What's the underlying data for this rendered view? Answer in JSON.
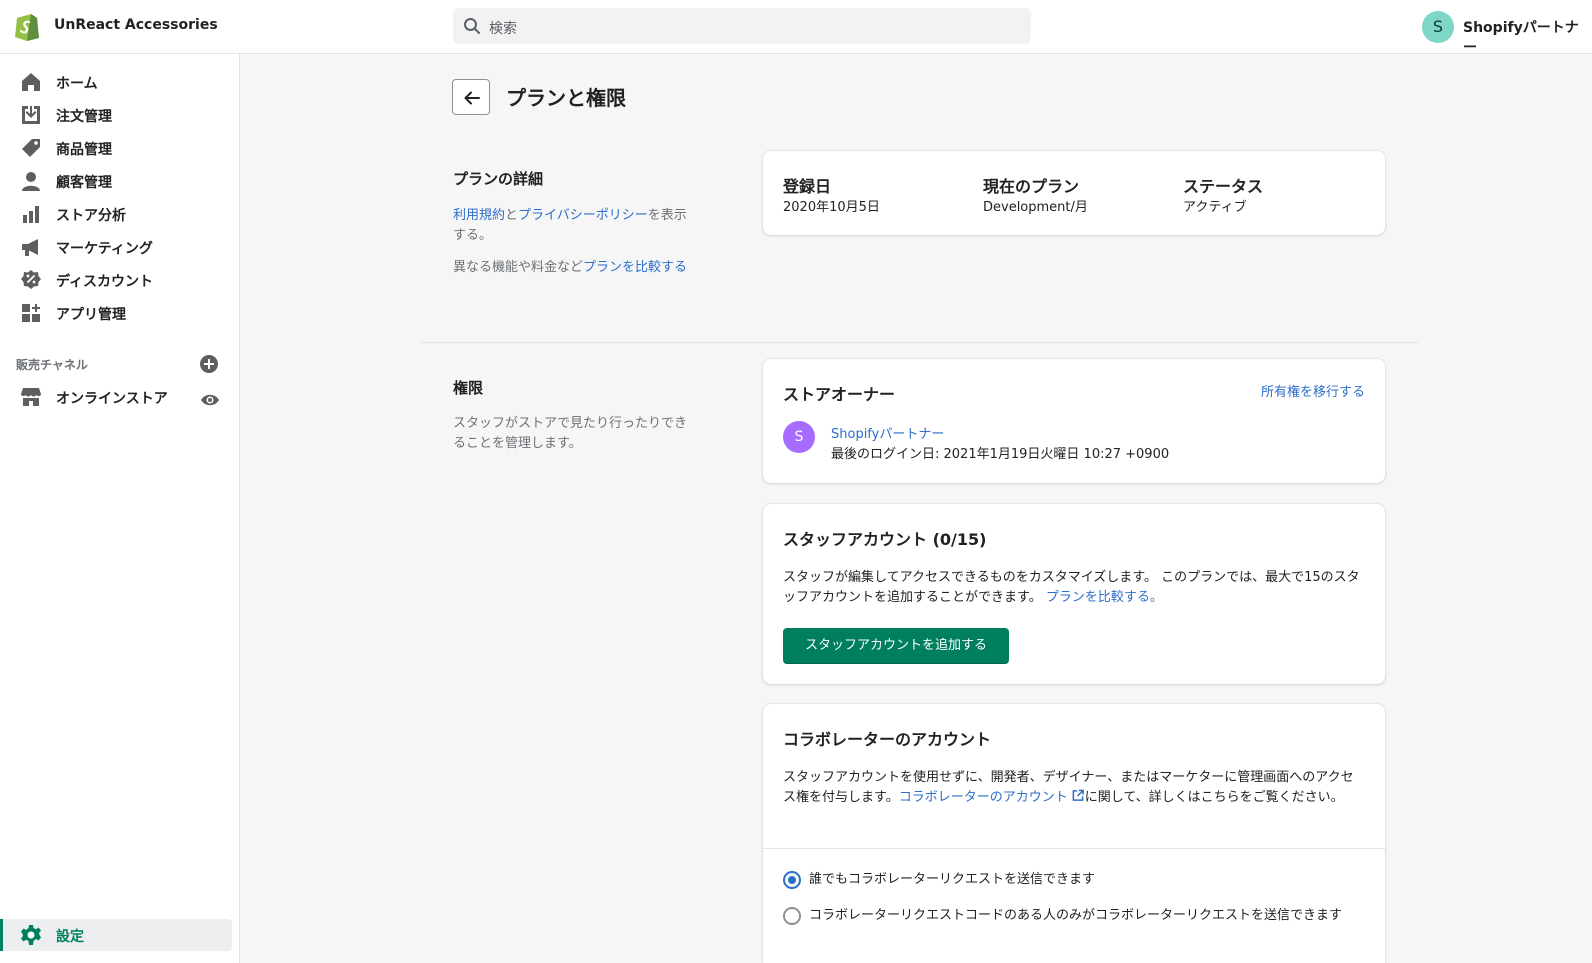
{
  "header": {
    "store_name": "UnReact Accessories",
    "search_placeholder": "検索",
    "user_initial": "S",
    "user_name": "Shopifyパートナー"
  },
  "sidebar": {
    "items": [
      {
        "label": "ホーム",
        "icon": "home-icon"
      },
      {
        "label": "注文管理",
        "icon": "orders-icon"
      },
      {
        "label": "商品管理",
        "icon": "tag-icon"
      },
      {
        "label": "顧客管理",
        "icon": "customer-icon"
      },
      {
        "label": "ストア分析",
        "icon": "analytics-icon"
      },
      {
        "label": "マーケティング",
        "icon": "megaphone-icon"
      },
      {
        "label": "ディスカウント",
        "icon": "discount-icon"
      },
      {
        "label": "アプリ管理",
        "icon": "apps-icon"
      }
    ],
    "channels_label": "販売チャネル",
    "online_store": "オンラインストア",
    "settings": "設定"
  },
  "page": {
    "title": "プランと権限"
  },
  "plan": {
    "section_title": "プランの詳細",
    "terms_link": "利用規約",
    "and": "と",
    "privacy_link": "プライバシーポリシー",
    "show_text": "を表示する。",
    "compare_prefix": "異なる機能や料金など",
    "compare_link": "プランを比較する",
    "cols": [
      {
        "label": "登録日",
        "value": "2020年10月5日"
      },
      {
        "label": "現在のプラン",
        "value": "Development/月"
      },
      {
        "label": "ステータス",
        "value": "アクティブ"
      }
    ]
  },
  "permissions": {
    "section_title": "権限",
    "description": "スタッフがストアで見たり行ったりできることを管理します。",
    "owner": {
      "title": "ストアオーナー",
      "transfer_link": "所有権を移行する",
      "initial": "S",
      "name": "Shopifyパートナー",
      "last_login": "最後のログイン日: 2021年1月19日火曜日 10:27 +0900"
    },
    "staff": {
      "title": "スタッフアカウント (0/15)",
      "text": "スタッフが編集してアクセスできるものをカスタマイズします。 このプランでは、最大で15のスタッフアカウントを追加することができます。 ",
      "compare_link": "プランを比較する。",
      "add_button": "スタッフアカウントを追加する"
    },
    "collab": {
      "title": "コラボレーターのアカウント",
      "text_before": "スタッフアカウントを使用せずに、開発者、デザイナー、またはマーケターに管理画面へのアクセス権を付与します。",
      "link": "コラボレーターのアカウント",
      "text_after": "に関して、詳しくはこちらをご覧ください。",
      "options": [
        {
          "label": "誰でもコラボレーターリクエストを送信できます",
          "selected": true
        },
        {
          "label": "コラボレーターリクエストコードのある人のみがコラボレーターリクエストを送信できます",
          "selected": false
        }
      ]
    }
  },
  "colors": {
    "accent": "#008060",
    "link": "#2c6ecb",
    "primary_button": "#007f5f"
  }
}
